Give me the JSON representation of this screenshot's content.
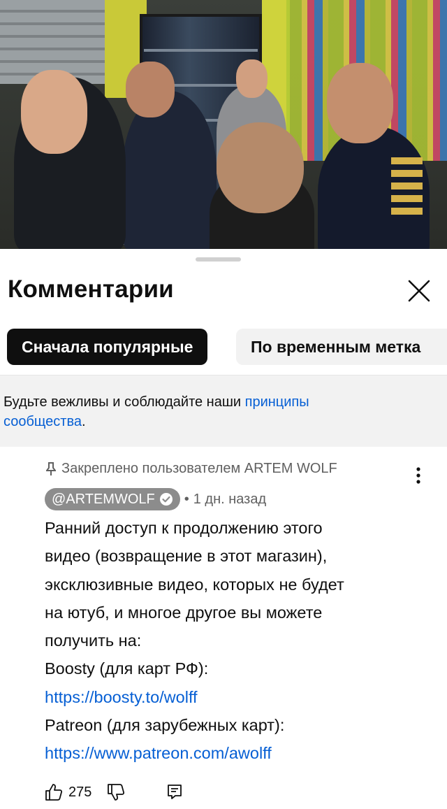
{
  "sheet": {
    "title": "Комментарии",
    "sort_chips": [
      {
        "label": "Сначала популярные",
        "active": true
      },
      {
        "label": "По временным метка",
        "active": false
      }
    ],
    "guidelines": {
      "text": "Будьте вежливы и соблюдайте наши ",
      "link": "принципы",
      "link2": "сообщества",
      "end": "."
    }
  },
  "comment": {
    "pinned_label": "Закреплено пользователем ARTEM WOLF",
    "author": "@ARTEMWOLF",
    "separator": "•",
    "time": "1 дн. назад",
    "lines": [
      "Ранний доступ к продолжению этого",
      "видео (возвращение в этот магазин),",
      "эксклюзивные видео, которых не будет",
      "на ютуб, и многое другое вы можете",
      "получить на:",
      "Boosty (для карт РФ):"
    ],
    "link1": "https://boosty.to/wolff",
    "line_patreon": "Patreon (для зарубежных карт):",
    "link2": "https://www.patreon.com/awolff",
    "likes": "275"
  },
  "icons": {
    "close": "close-icon",
    "pin": "pin-icon",
    "verified": "verified-check-icon",
    "more": "more-vert-icon",
    "like": "thumb-up-icon",
    "dislike": "thumb-down-icon",
    "reply": "reply-comment-icon"
  },
  "colors": {
    "link": "#065fd4",
    "chip_active_bg": "#0f0f0f",
    "chip_inactive_bg": "#f2f2f2",
    "author_chip_bg": "#8c8c8c",
    "secondary_text": "#606060"
  }
}
